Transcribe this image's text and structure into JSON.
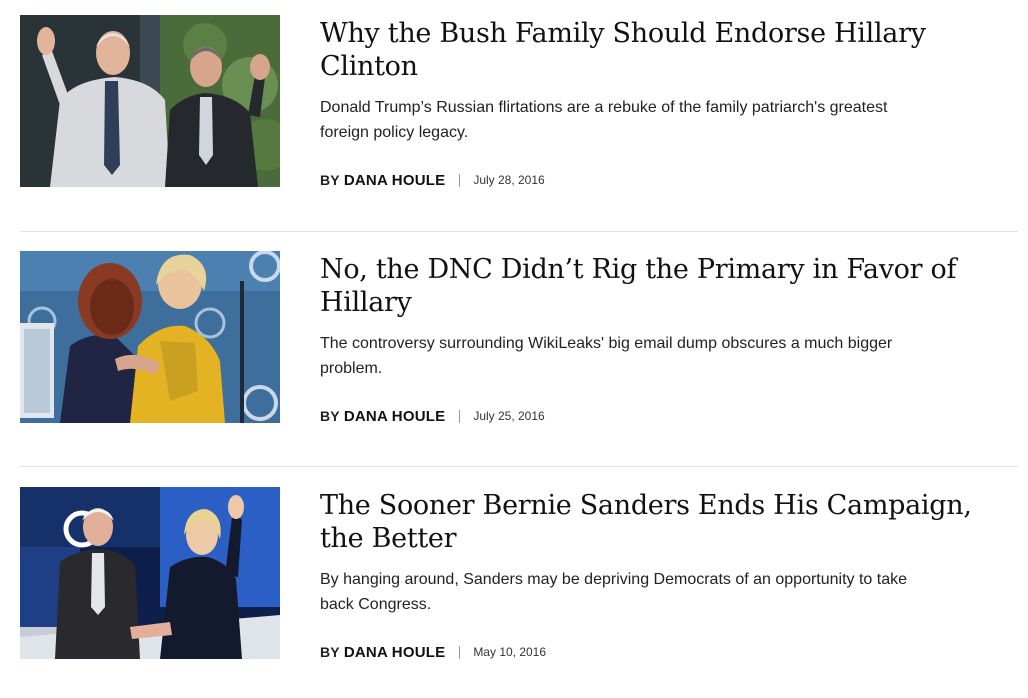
{
  "articles": [
    {
      "title": "Why the Bush Family Should Endorse Hillary Clinton",
      "dek": "Donald Trump’s Russian flirtations are a rebuke of the family patriarch's greatest foreign policy legacy.",
      "by_label": "BY",
      "author": "DANA HOULE",
      "date": "July 28, 2016"
    },
    {
      "title": "No, the DNC Didn’t Rig the Primary in Favor of Hillary",
      "dek": "The controversy surrounding WikiLeaks' big email dump obscures a much bigger problem.",
      "by_label": "BY",
      "author": "DANA HOULE",
      "date": "July 25, 2016"
    },
    {
      "title": "The Sooner Bernie Sanders Ends His Campaign, the Better",
      "dek": "By hanging around, Sanders may be depriving Democrats of an opportunity to take back Congress.",
      "by_label": "BY",
      "author": "DANA HOULE",
      "date": "May 10, 2016"
    }
  ],
  "colors": {
    "divider": "#e3e3e3",
    "text": "#222222",
    "headline": "#111111"
  }
}
